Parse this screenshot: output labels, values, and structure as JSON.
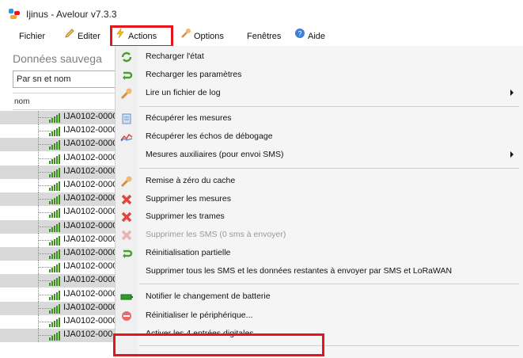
{
  "window": {
    "title": "Ijinus - Avelour v7.3.3"
  },
  "menubar": {
    "items": [
      {
        "label": "Fichier",
        "icon": "none"
      },
      {
        "label": "Editer",
        "icon": "pencil-icon"
      },
      {
        "label": "Actions",
        "icon": "lightning-icon"
      },
      {
        "label": "Options",
        "icon": "wrench-icon"
      },
      {
        "label": "Fenêtres",
        "icon": "none"
      },
      {
        "label": "Aide",
        "icon": "help-icon"
      }
    ]
  },
  "left_panel": {
    "title": "Données sauvega",
    "combo_value": "Par sn et nom",
    "column_header": "nom",
    "rows": [
      "IJA0102-0000",
      "IJA0102-0000",
      "IJA0102-0000",
      "IJA0102-0000",
      "IJA0102-0000",
      "IJA0102-0000",
      "IJA0102-0000",
      "IJA0102-0000",
      "IJA0102-0000",
      "IJA0102-0000",
      "IJA0102-0000",
      "IJA0102-0000",
      "IJA0102-0000",
      "IJA0102-0000",
      "IJA0102-0000",
      "IJA0102-0000",
      "IJA0102-000"
    ]
  },
  "actions_menu": {
    "items": [
      {
        "label": "Recharger l'état",
        "icon": "refresh-icon"
      },
      {
        "label": "Recharger les paramètres",
        "icon": "reload-icon"
      },
      {
        "label": "Lire un fichier de log",
        "icon": "wrench-icon",
        "submenu": true
      },
      {
        "label": "Récupérer les mesures",
        "icon": "document-icon"
      },
      {
        "label": "Récupérer les échos de débogage",
        "icon": "graph-icon"
      },
      {
        "label": "Mesures auxiliaires (pour envoi SMS)",
        "icon": "none",
        "submenu": true
      },
      {
        "label": "Remise à zéro du cache",
        "icon": "wrench-icon"
      },
      {
        "label": "Supprimer les mesures",
        "icon": "delete-icon"
      },
      {
        "label": "Supprimer les trames",
        "icon": "delete-icon"
      },
      {
        "label": "Supprimer les SMS (0 sms à envoyer)",
        "icon": "delete-icon",
        "disabled": true
      },
      {
        "label": "Réinitialisation partielle",
        "icon": "reload-icon"
      },
      {
        "label": "Supprimer tous les SMS et les données restantes à envoyer par SMS et LoRaWAN",
        "icon": "none"
      },
      {
        "label": "Notifier le changement de batterie",
        "icon": "battery-icon"
      },
      {
        "label": "Réinitialiser le périphérique...",
        "icon": "reset-icon"
      },
      {
        "label": "Activer les 4 entrées digitales",
        "icon": "none"
      }
    ]
  },
  "colors": {
    "highlight": "#e8141c",
    "alt_row": "#d9d9d9",
    "menu_bg": "#f5f5f5"
  }
}
